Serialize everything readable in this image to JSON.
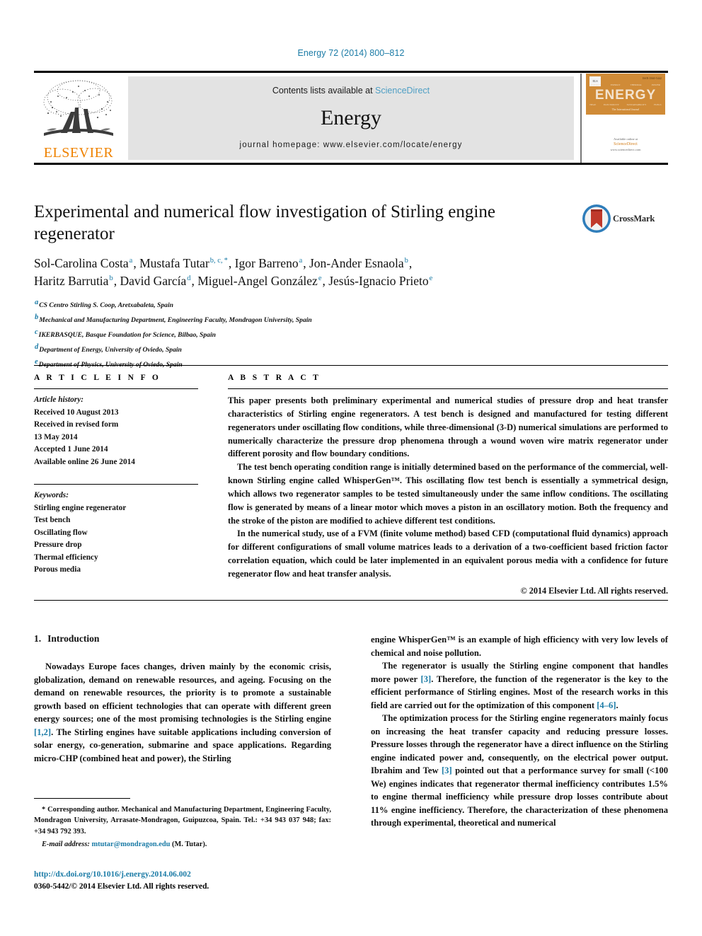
{
  "running_head": "Energy 72 (2014) 800–812",
  "masthead": {
    "contents_prefix": "Contents lists available at",
    "sciencedirect": "ScienceDirect",
    "journal_name": "Energy",
    "homepage": "journal homepage: www.elsevier.com/locate/energy",
    "publisher_wordmark": "ELSEVIER",
    "cover": {
      "title": "ENERGY",
      "els_mark": "ELS",
      "isbn_line": "ISSN 0360-5442",
      "tagline": "The International Journal",
      "top_labels": [
        "ENERGY",
        "EXERGY",
        "THERMAL",
        "POWER"
      ],
      "bottom_labels": [
        "HEAT",
        "ELECTRICITY",
        "SUSTAINABILITY",
        "FUELS"
      ],
      "available_at": "Available online at",
      "sd_word": "ScienceDirect",
      "sd_url": "www.sciencedirect.com"
    }
  },
  "article": {
    "title": "Experimental and numerical flow investigation of Stirling engine regenerator",
    "crossmark_label": "CrossMark",
    "authors_line1": [
      {
        "name": "Sol-Carolina Costa",
        "sup": "a",
        "sep": ", "
      },
      {
        "name": "Mustafa Tutar",
        "sup": "b, c, *",
        "sep": ", "
      },
      {
        "name": "Igor Barreno",
        "sup": "a",
        "sep": ", "
      },
      {
        "name": "Jon-Ander Esnaola",
        "sup": "b",
        "sep": ","
      }
    ],
    "authors_line2": [
      {
        "name": "Haritz Barrutia",
        "sup": "b",
        "sep": ", "
      },
      {
        "name": "David García",
        "sup": "d",
        "sep": ", "
      },
      {
        "name": "Miguel-Angel González",
        "sup": "e",
        "sep": ", "
      },
      {
        "name": "Jesús-Ignacio Prieto",
        "sup": "e",
        "sep": ""
      }
    ],
    "affiliations": [
      {
        "sup": "a",
        "text": "CS Centro Stirling S. Coop, Aretxabaleta, Spain"
      },
      {
        "sup": "b",
        "text": "Mechanical and Manufacturing Department, Engineering Faculty, Mondragon University, Spain"
      },
      {
        "sup": "c",
        "text": "IKERBASQUE, Basque Foundation for Science, Bilbao, Spain"
      },
      {
        "sup": "d",
        "text": "Department of Energy, University of Oviedo, Spain"
      },
      {
        "sup": "e",
        "text": "Department of Physics, University of Oviedo, Spain"
      }
    ]
  },
  "article_info": {
    "heading": "A R T I C L E   I N F O",
    "history_label": "Article history:",
    "history": [
      "Received 10 August 2013",
      "Received in revised form",
      "13 May 2014",
      "Accepted 1 June 2014",
      "Available online 26 June 2014"
    ],
    "keywords_label": "Keywords:",
    "keywords": [
      "Stirling engine regenerator",
      "Test bench",
      "Oscillating flow",
      "Pressure drop",
      "Thermal efficiency",
      "Porous media"
    ]
  },
  "abstract": {
    "heading": "A B S T R A C T",
    "paragraphs": [
      "This paper presents both preliminary experimental and numerical studies of pressure drop and heat transfer characteristics of Stirling engine regenerators. A test bench is designed and manufactured for testing different regenerators under oscillating flow conditions, while three-dimensional (3-D) numerical simulations are performed to numerically characterize the pressure drop phenomena through a wound woven wire matrix regenerator under different porosity and flow boundary conditions.",
      "The test bench operating condition range is initially determined based on the performance of the commercial, well-known Stirling engine called WhisperGen™. This oscillating flow test bench is essentially a symmetrical design, which allows two regenerator samples to be tested simultaneously under the same inflow conditions. The oscillating flow is generated by means of a linear motor which moves a piston in an oscillatory motion. Both the frequency and the stroke of the piston are modified to achieve different test conditions.",
      "In the numerical study, use of a FVM (finite volume method) based CFD (computational fluid dynamics) approach for different configurations of small volume matrices leads to a derivation of a two-coefficient based friction factor correlation equation, which could be later implemented in an equivalent porous media with a confidence for future regenerator flow and heat transfer analysis."
    ],
    "copyright": "© 2014 Elsevier Ltd. All rights reserved."
  },
  "introduction": {
    "number": "1.",
    "title": "Introduction",
    "left_col": [
      {
        "type": "para",
        "segments": [
          {
            "t": "Nowadays Europe faces changes, driven mainly by the economic crisis, globalization, demand on renewable resources, and ageing. Focusing on the demand on renewable resources, the priority is to promote a sustainable growth based on efficient technologies that can operate with different green energy sources; one of the most promising technologies is the Stirling engine "
          },
          {
            "t": "[1,2]",
            "ref": true
          },
          {
            "t": ". The Stirling engines have suitable applications including conversion of solar energy, co-generation, submarine and space applications. Regarding micro-CHP (combined heat and power), the Stirling"
          }
        ]
      }
    ],
    "right_col": [
      {
        "type": "para",
        "indent": false,
        "segments": [
          {
            "t": "engine WhisperGen™ is an example of high efficiency with very low levels of chemical and noise pollution."
          }
        ]
      },
      {
        "type": "para",
        "indent": true,
        "segments": [
          {
            "t": "The regenerator is usually the Stirling engine component that handles more power "
          },
          {
            "t": "[3]",
            "ref": true
          },
          {
            "t": ". Therefore, the function of the regenerator is the key to the efficient performance of Stirling engines. Most of the research works in this field are carried out for the optimization of this component "
          },
          {
            "t": "[4–6]",
            "ref": true
          },
          {
            "t": "."
          }
        ]
      },
      {
        "type": "para",
        "indent": true,
        "segments": [
          {
            "t": "The optimization process for the Stirling engine regenerators mainly focus on increasing the heat transfer capacity and reducing pressure losses. Pressure losses through the regenerator have a direct influence on the Stirling engine indicated power and, consequently, on the electrical power output. Ibrahim and Tew "
          },
          {
            "t": "[3]",
            "ref": true
          },
          {
            "t": " pointed out that a performance survey for small (<100 We) engines indicates that regenerator thermal inefficiency contributes 1.5% to engine thermal inefficiency while pressure drop losses contribute about 11% engine inefficiency. Therefore, the characterization of these phenomena through experimental, theoretical and numerical"
          }
        ]
      }
    ]
  },
  "footnotes": {
    "corresponding": "* Corresponding author. Mechanical and Manufacturing Department, Engineering Faculty, Mondragon University, Arrasate-Mondragon, Guipuzcoa, Spain. Tel.: +34 943 037 948; fax: +34 943 792 393.",
    "email_label": "E-mail address:",
    "email": "mtutar@mondragon.edu",
    "email_owner": "(M. Tutar).",
    "doi": "http://dx.doi.org/10.1016/j.energy.2014.06.002",
    "issn_line": "0360-5442/© 2014 Elsevier Ltd. All rights reserved."
  },
  "colors": {
    "link_blue": "#1b7ba6",
    "sciencedirect_blue": "#4f9fc4",
    "elsevier_orange": "#ef8200",
    "cover_orange": "#d08b37",
    "crossmark_blue": "#2e7dba",
    "crossmark_red": "#c0392b"
  }
}
